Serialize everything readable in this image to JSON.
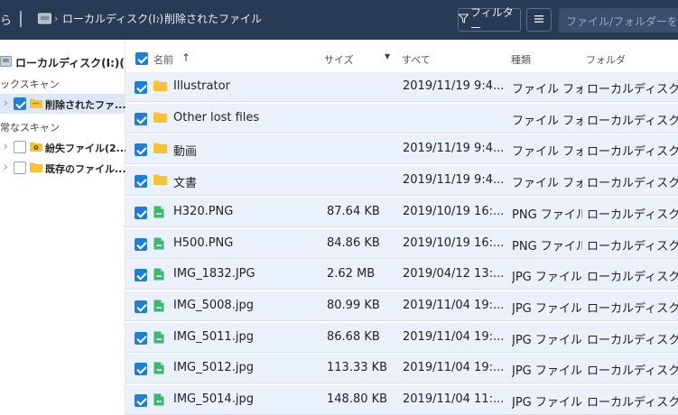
{
  "toolbar": {
    "back_glyph": "ら",
    "crumb_arrow": "›",
    "breadcrumb": [
      "ローカルディスク(I:)",
      "削除されたファイル"
    ],
    "filter_label": "フィルター",
    "search_placeholder": "ファイル/フォルダーを検索"
  },
  "sidebar": {
    "root_label": "ローカルディスク(I:)(...",
    "sections": [
      {
        "label": "ックスキャン"
      },
      {
        "label": "常なスキャン"
      }
    ],
    "items": [
      {
        "label": "削除されたファ...",
        "checked": true,
        "selected": true
      },
      {
        "label": "紛失ファイル(2...",
        "checked": false,
        "selected": false
      },
      {
        "label": "既存のファイル...",
        "checked": false,
        "selected": false
      }
    ]
  },
  "table": {
    "headers": {
      "name": "名前",
      "size": "サイズ",
      "date_filter": "すべて",
      "type": "種類",
      "folder": "フォルダ"
    },
    "rows": [
      {
        "icon": "folder-icon",
        "name": "Illustrator",
        "size": "",
        "date": "2019/11/19 9:4...",
        "type": "ファイル フォ...",
        "folder": "ローカルディスク(I:)¥"
      },
      {
        "icon": "folder-icon",
        "name": "Other lost files",
        "size": "",
        "date": "",
        "type": "ファイル フォ...",
        "folder": "ローカルディスク(I:)¥"
      },
      {
        "icon": "folder-icon",
        "name": "動画",
        "size": "",
        "date": "2019/11/19 9:4...",
        "type": "ファイル フォ...",
        "folder": "ローカルディスク(I:)¥"
      },
      {
        "icon": "folder-icon",
        "name": "文書",
        "size": "",
        "date": "2019/11/19 9:4...",
        "type": "ファイル フォ...",
        "folder": "ローカルディスク(I:)¥"
      },
      {
        "icon": "image-file-icon",
        "name": "H320.PNG",
        "size": "87.64 KB",
        "date": "2019/10/19 16:...",
        "type": "PNG ファイル",
        "folder": "ローカルディスク(I:)¥"
      },
      {
        "icon": "image-file-icon",
        "name": "H500.PNG",
        "size": "84.86 KB",
        "date": "2019/10/19 16:...",
        "type": "PNG ファイル",
        "folder": "ローカルディスク(I:)¥"
      },
      {
        "icon": "image-file-icon",
        "name": "IMG_1832.JPG",
        "size": "2.62 MB",
        "date": "2019/04/12 13:...",
        "type": "JPG ファイル",
        "folder": "ローカルディスク(I:)¥"
      },
      {
        "icon": "image-file-icon",
        "name": "IMG_5008.jpg",
        "size": "80.99 KB",
        "date": "2019/11/04 19:...",
        "type": "JPG ファイル",
        "folder": "ローカルディスク(I:)¥"
      },
      {
        "icon": "image-file-icon",
        "name": "IMG_5011.jpg",
        "size": "86.68 KB",
        "date": "2019/11/04 19:...",
        "type": "JPG ファイル",
        "folder": "ローカルディスク(I:)¥"
      },
      {
        "icon": "image-file-icon",
        "name": "IMG_5012.jpg",
        "size": "113.33 KB",
        "date": "2019/11/04 19:...",
        "type": "JPG ファイル",
        "folder": "ローカルディスク(I:)¥"
      },
      {
        "icon": "image-file-icon",
        "name": "IMG_5014.jpg",
        "size": "148.80 KB",
        "date": "2019/11/04 11:...",
        "type": "JPG ファイル",
        "folder": "ローカルディスク(I:)¥"
      }
    ]
  },
  "colors": {
    "toolbar_bg": "#273b55",
    "accent": "#1f7fd6",
    "row_bg": "#eaf1fb",
    "folder_yellow": "#f5c23a",
    "image_file_green": "#3bb873"
  }
}
